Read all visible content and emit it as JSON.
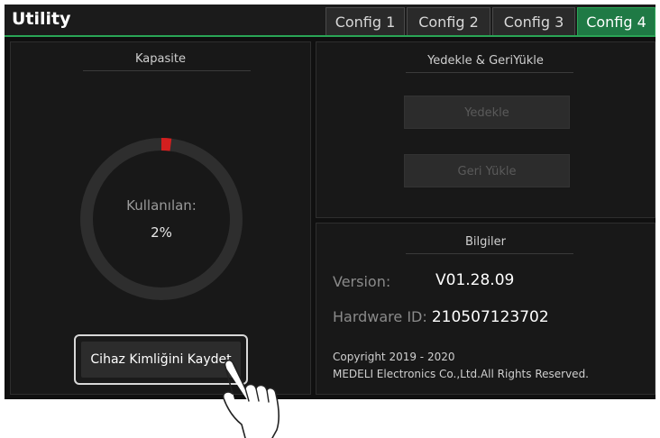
{
  "app": {
    "title": "Utility"
  },
  "tabs": [
    {
      "label": "Config 1"
    },
    {
      "label": "Config 2"
    },
    {
      "label": "Config 3"
    },
    {
      "label": "Config 4"
    }
  ],
  "capacity": {
    "title": "Kapasite",
    "used_label": "Kullanılan:",
    "used_value": "2%",
    "used_fraction": 0.02,
    "save_id_button": "Cihaz Kimliğini Kaydet"
  },
  "backup": {
    "title": "Yedekle & GeriYükle",
    "backup_button": "Yedekle",
    "restore_button": "Geri Yükle"
  },
  "info": {
    "title": "Bilgiler",
    "version_label": "Version:",
    "version_value": "V01.28.09",
    "hardware_label": "Hardware ID:",
    "hardware_value": "210507123702",
    "copyright_line1": "Copyright 2019 - 2020",
    "copyright_line2": "MEDELI Electronics Co.,Ltd.All Rights Reserved."
  },
  "colors": {
    "accent": "#1f7a45",
    "gauge_fill": "#d21f1f",
    "gauge_track": "#2e2e2e"
  },
  "icons": {
    "pointer": "pointing-hand-icon"
  }
}
